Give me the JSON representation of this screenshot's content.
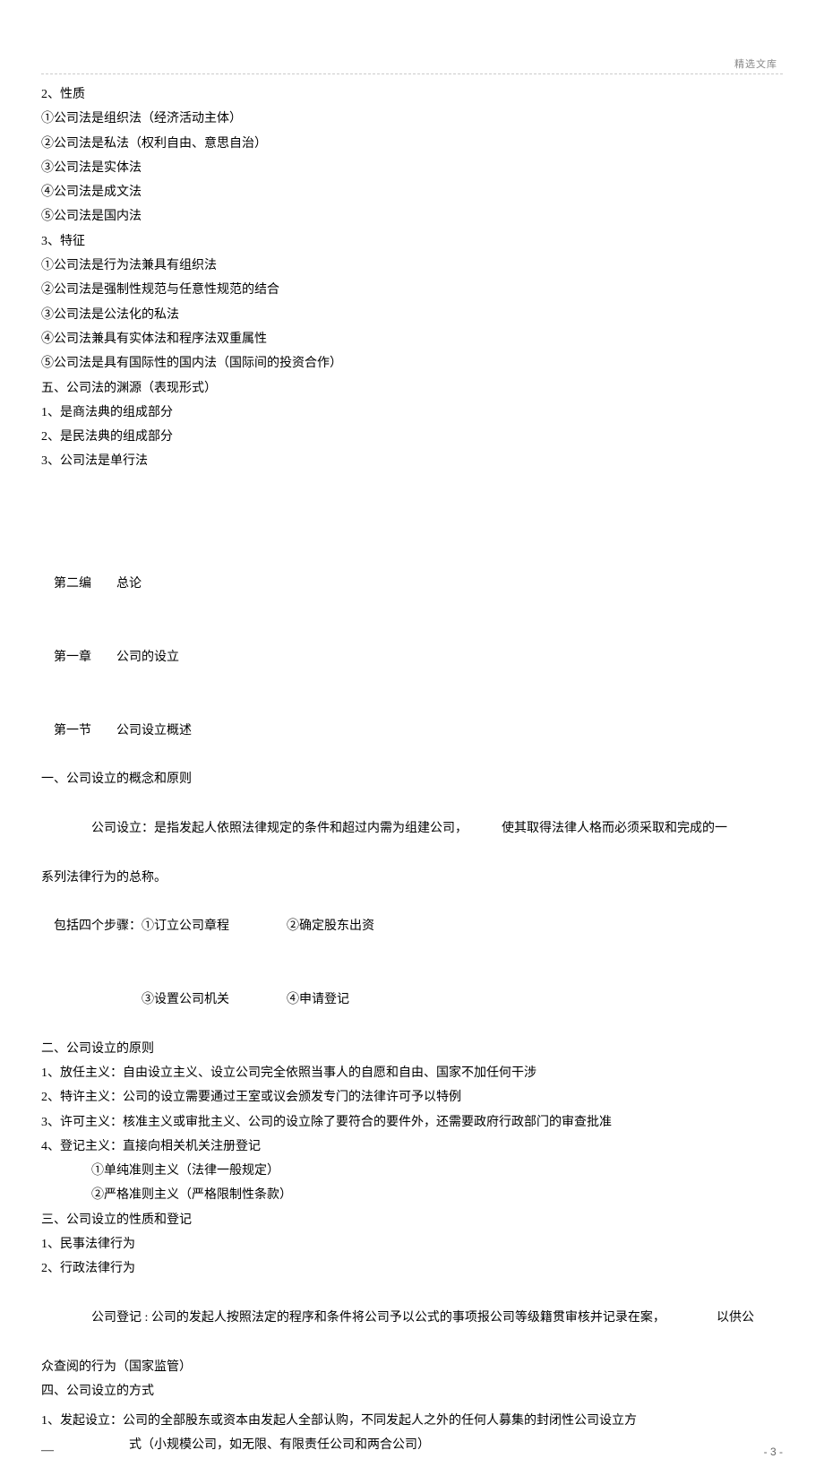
{
  "watermark": "精选文库",
  "lines": {
    "l01": "2、性质",
    "l02": "①公司法是组织法（经济活动主体）",
    "l03": "②公司法是私法（权利自由、意思自治）",
    "l04": "③公司法是实体法",
    "l05": "④公司法是成文法",
    "l06": "⑤公司法是国内法",
    "l07": "3、特征",
    "l08": "①公司法是行为法兼具有组织法",
    "l09": "②公司法是强制性规范与任意性规范的结合",
    "l10": "③公司法是公法化的私法",
    "l11": "④公司法兼具有实体法和程序法双重属性",
    "l12": "⑤公司法是具有国际性的国内法（国际间的投资合作）",
    "l13": "五、公司法的渊源（表现形式）",
    "l14": "1、是商法典的组成部分",
    "l15": "2、是民法典的组成部分",
    "l16": "3、公司法是单行法",
    "l17a": "第二编",
    "l17b": "总论",
    "l18a": "第一章",
    "l18b": "公司的设立",
    "l19a": "第一节",
    "l19b": "公司设立概述",
    "l20": "一、公司设立的概念和原则",
    "l21a": "公司设立：是指发起人依照法律规定的条件和超过内需为组建公司，",
    "l21b": "使其取得法律人格而必须采取和完成的一",
    "l22": "系列法律行为的总称。",
    "l23a": "包括四个步骤：①订立公司章程",
    "l23b": "②确定股东出资",
    "l24a": "③设置公司机关",
    "l24b": "④申请登记",
    "l25": "二、公司设立的原则",
    "l26": "1、放任主义：自由设立主义、设立公司完全依照当事人的自愿和自由、国家不加任何干涉",
    "l27": "2、特许主义：公司的设立需要通过王室或议会颁发专门的法律许可予以特例",
    "l28": "3、许可主义：核准主义或审批主义、公司的设立除了要符合的要件外，还需要政府行政部门的审查批准",
    "l29": "4、登记主义：直接向相关机关注册登记",
    "l30": "①单纯准则主义（法律一般规定）",
    "l31": "②严格准则主义（严格限制性条款）",
    "l32": "三、公司设立的性质和登记",
    "l33": "1、民事法律行为",
    "l34": "2、行政法律行为",
    "l35a": "公司登记 : 公司的发起人按照法定的程序和条件将公司予以公式的事项报公司等级籍贯审核并记录在案，",
    "l35b": "以供公",
    "l36": "众查阅的行为（国家监管）",
    "l37": "四、公司设立的方式",
    "l38": "1、发起设立：公司的全部股东或资本由发起人全部认购，不同发起人之外的任何人募集的封闭性公司设立方",
    "l39": "式（小规模公司，如无限、有限责任公司和两合公司）"
  },
  "page_number": "- 3 -",
  "dash": "—"
}
